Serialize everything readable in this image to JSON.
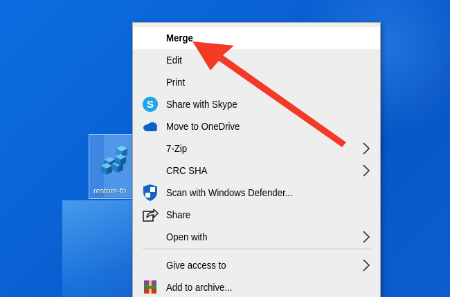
{
  "desktop": {
    "icon_label": "restore-fo"
  },
  "menu": {
    "items": [
      {
        "label": "Merge",
        "icon": "none",
        "submenu": false,
        "default": true
      },
      {
        "label": "Edit",
        "icon": "none",
        "submenu": false
      },
      {
        "label": "Print",
        "icon": "none",
        "submenu": false
      },
      {
        "label": "Share with Skype",
        "icon": "skype-icon",
        "submenu": false
      },
      {
        "label": "Move to OneDrive",
        "icon": "onedrive-icon",
        "submenu": false
      },
      {
        "label": "7-Zip",
        "icon": "none",
        "submenu": true
      },
      {
        "label": "CRC SHA",
        "icon": "none",
        "submenu": true
      },
      {
        "label": "Scan with Windows Defender...",
        "icon": "windows-defender-icon",
        "submenu": false
      },
      {
        "label": "Share",
        "icon": "share-icon",
        "submenu": false
      },
      {
        "label": "Open with",
        "icon": "none",
        "submenu": true
      },
      {
        "label": "Give access to",
        "icon": "none",
        "submenu": true
      },
      {
        "label": "Add to archive...",
        "icon": "winrar-icon",
        "submenu": false
      }
    ]
  },
  "colors": {
    "desktop_blue": "#0a63d6",
    "menu_bg": "#eeeeee",
    "highlight": "#ffffff",
    "arrow_red": "#f23a26",
    "skype_blue": "#1ea4e9",
    "onedrive_blue": "#0a64c8"
  }
}
